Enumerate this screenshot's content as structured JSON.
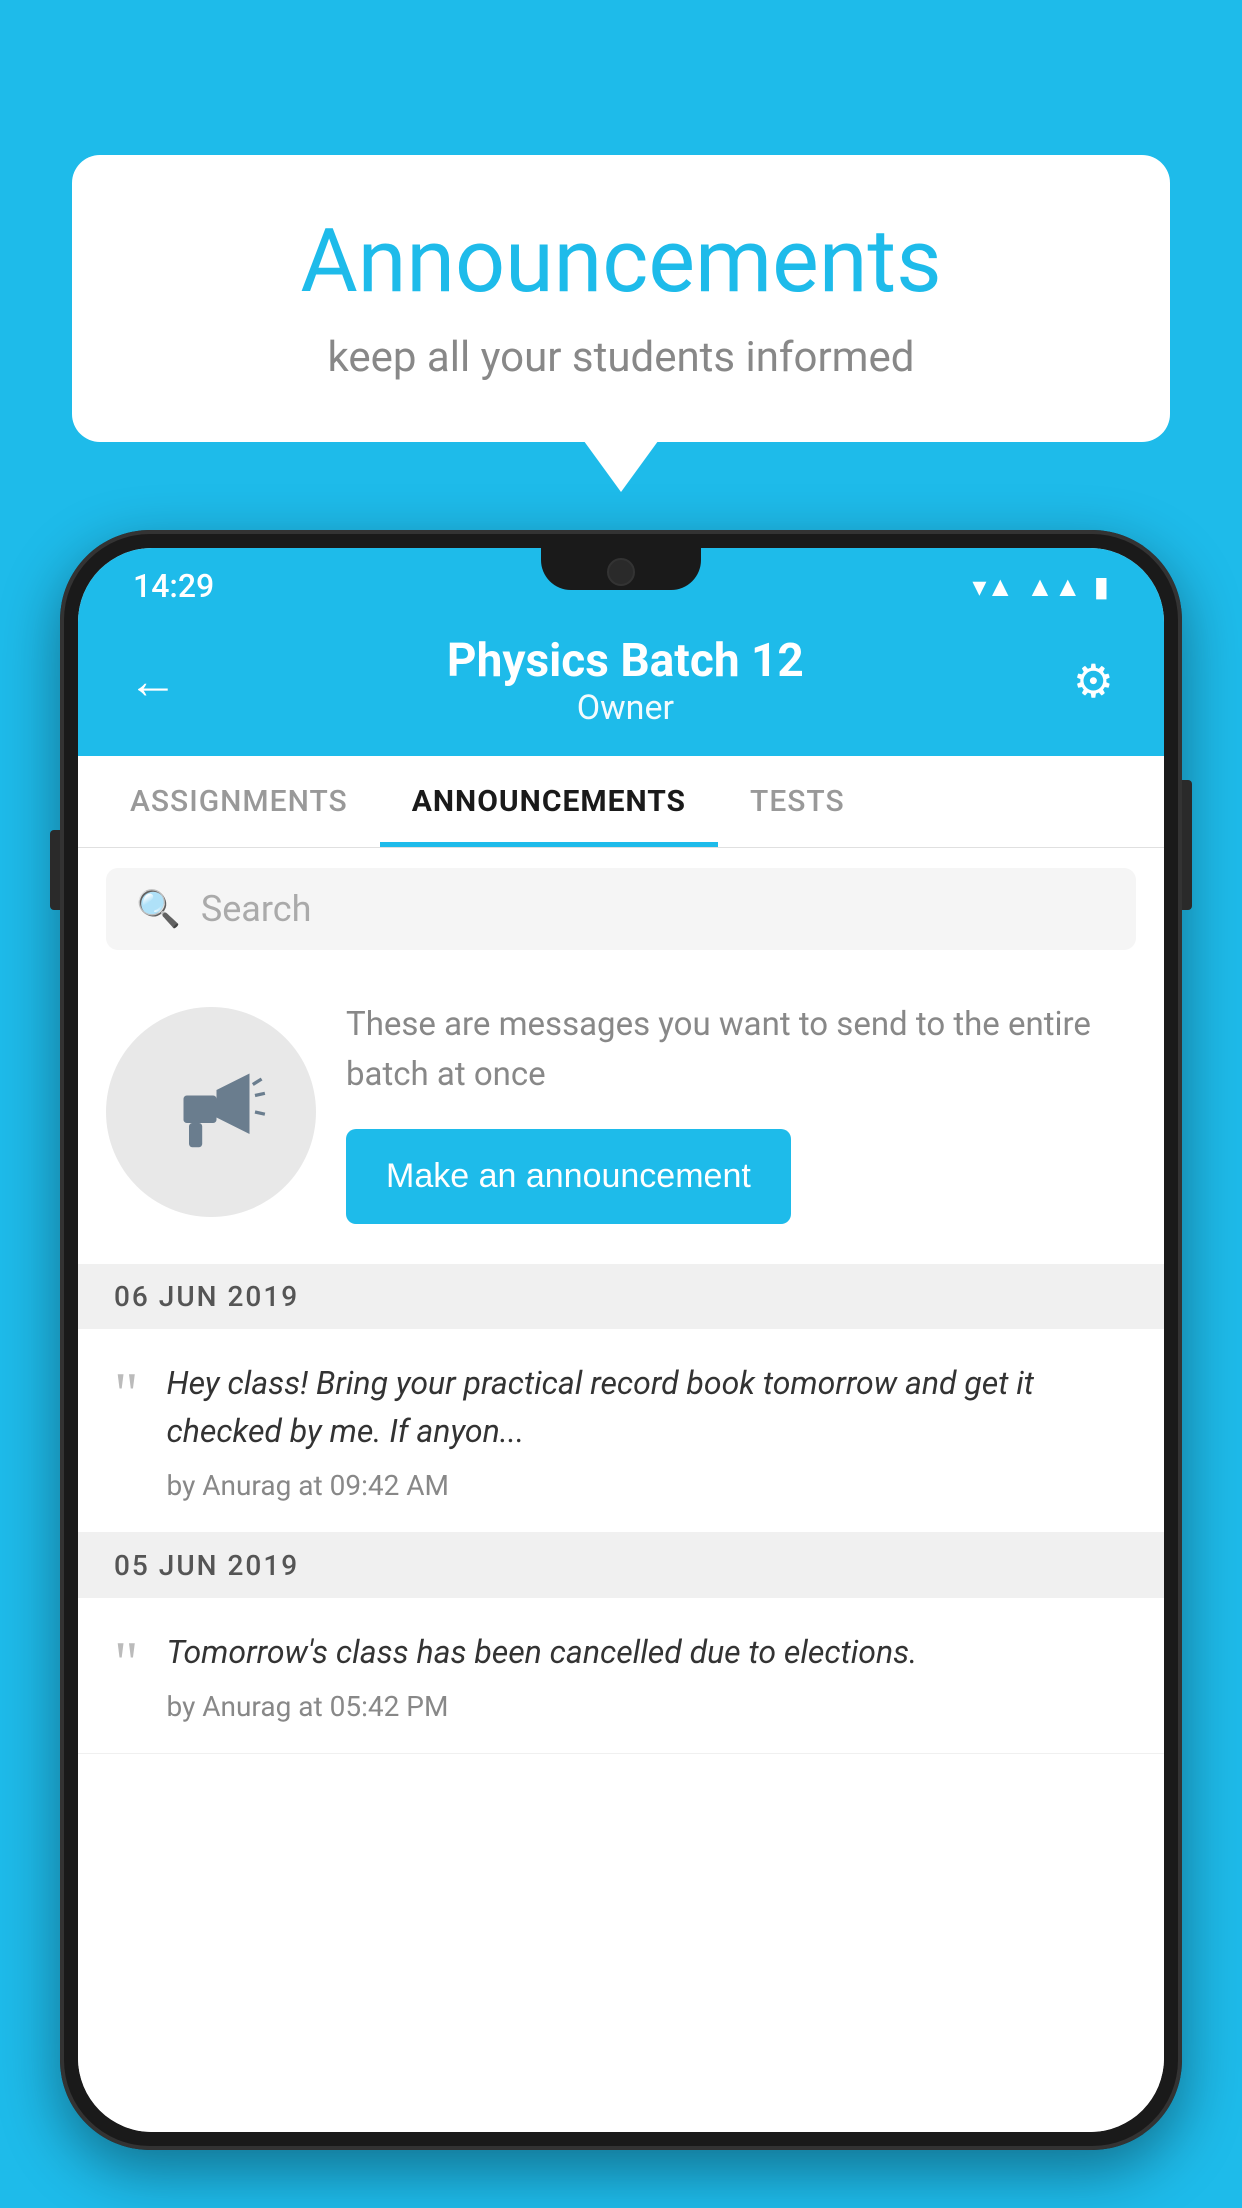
{
  "background_color": "#1EBBEA",
  "speech_bubble": {
    "title": "Announcements",
    "subtitle": "keep all your students informed"
  },
  "status_bar": {
    "time": "14:29",
    "wifi_icon": "wifi",
    "signal_icon": "signal",
    "battery_icon": "battery"
  },
  "header": {
    "back_label": "←",
    "batch_name": "Physics Batch 12",
    "role": "Owner",
    "settings_icon": "⚙"
  },
  "tabs": [
    {
      "label": "ASSIGNMENTS",
      "active": false
    },
    {
      "label": "ANNOUNCEMENTS",
      "active": true
    },
    {
      "label": "TESTS",
      "active": false
    }
  ],
  "search": {
    "placeholder": "Search"
  },
  "promo": {
    "description": "These are messages you want to send to the entire batch at once",
    "button_label": "Make an announcement"
  },
  "announcements": [
    {
      "date": "06  JUN  2019",
      "items": [
        {
          "message": "Hey class! Bring your practical record book tomorrow and get it checked by me. If anyon...",
          "author": "by Anurag at 09:42 AM"
        }
      ]
    },
    {
      "date": "05  JUN  2019",
      "items": [
        {
          "message": "Tomorrow's class has been cancelled due to elections.",
          "author": "by Anurag at 05:42 PM"
        }
      ]
    }
  ]
}
